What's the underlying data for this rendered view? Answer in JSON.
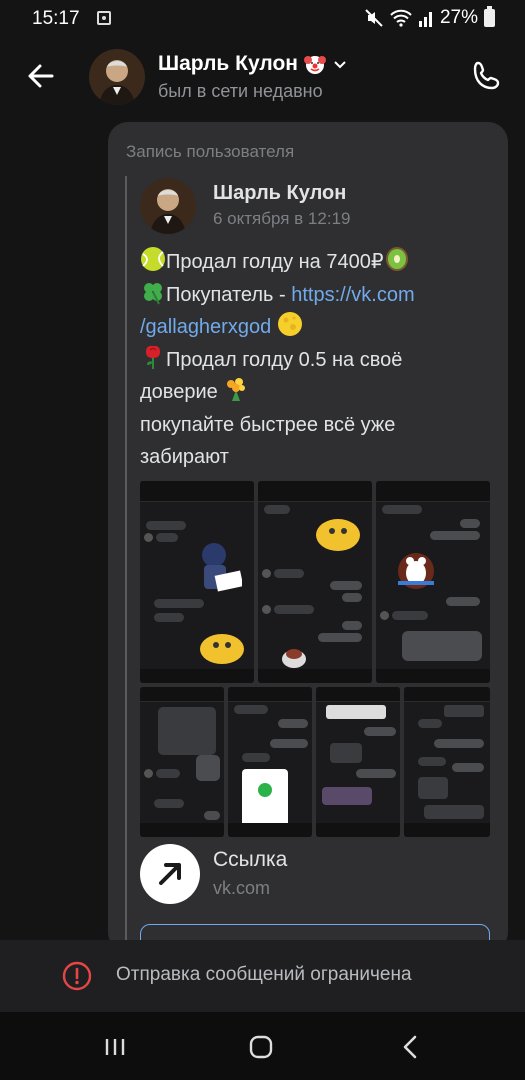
{
  "status_bar": {
    "time": "15:17",
    "battery": "27%"
  },
  "header": {
    "name": "Шарль Кулон",
    "name_emoji": "clown-face-emoji",
    "status": "был в сети недавно"
  },
  "message": {
    "forward_label": "Запись пользователя",
    "post": {
      "author": "Шарль Кулон",
      "date": "6 октября в 12:19",
      "lines": [
        {
          "prefix_emoji": "tennis-ball-emoji",
          "text": "Продал голду на 7400₽",
          "suffix_emoji": "kiwi-emoji"
        },
        {
          "prefix_emoji": "four-leaf-clover-emoji",
          "text": "Покупатель - ",
          "link": "https://vk.com/gallagherxgod",
          "suffix_emoji": "full-moon-emoji"
        },
        {
          "prefix_emoji": "rose-emoji",
          "text": "Продал голду 0.5 на своё доверие",
          "suffix_emoji": "bouquet-emoji"
        },
        {
          "text": "покупайте быстрее всё уже забирают"
        }
      ],
      "link_part1": "https://vk.com",
      "link_part2": "/gallagherxgod"
    },
    "link_card": {
      "title": "Ссылка",
      "domain": "vk.com"
    }
  },
  "restriction": {
    "text": "Отправка сообщений ограничена"
  },
  "colors": {
    "background": "#141414",
    "bubble": "#2f2f31",
    "link": "#71aaeb",
    "warning": "#e64646"
  }
}
